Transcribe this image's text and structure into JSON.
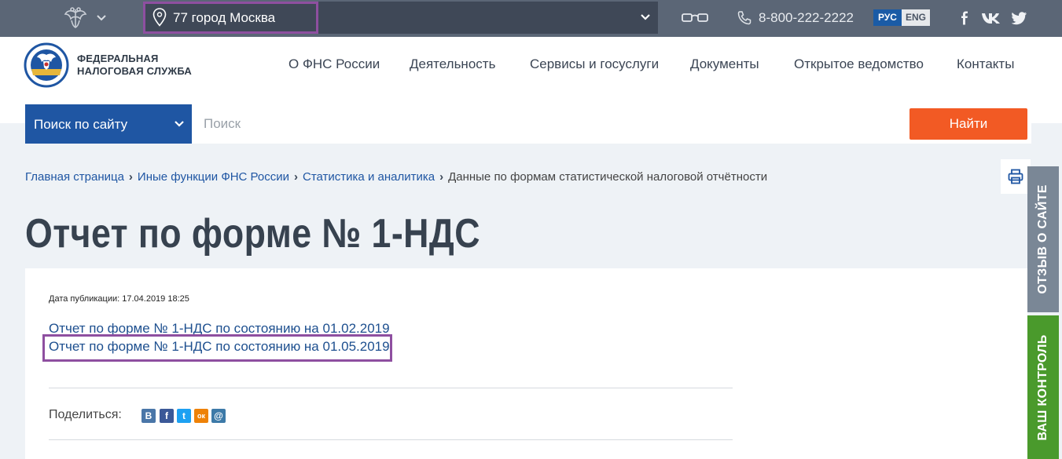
{
  "topbar": {
    "region": "77 город Москва",
    "phone": "8-800-222-2222",
    "lang_ru": "РУС",
    "lang_en": "ENG"
  },
  "header": {
    "logo_line1": "ФЕДЕРАЛЬНАЯ",
    "logo_line2": "НАЛОГОВАЯ СЛУЖБА",
    "nav": [
      "О ФНС России",
      "Деятельность",
      "Сервисы и госуслуги",
      "Документы",
      "Открытое ведомство",
      "Контакты"
    ]
  },
  "search": {
    "scope": "Поиск по сайту",
    "placeholder": "Поиск",
    "button": "Найти"
  },
  "breadcrumb": [
    "Главная страница",
    "Иные функции ФНС России",
    "Статистика и аналитика",
    "Данные по формам статистической налоговой отчётности"
  ],
  "page_title": "Отчет по форме № 1-НДС",
  "content": {
    "publication_date": "Дата публикации: 17.04.2019 18:25",
    "links": [
      "Отчет по форме № 1-НДС по состоянию на 01.02.2019",
      "Отчет по форме № 1-НДС по состоянию на 01.05.2019"
    ],
    "share_label": "Поделиться:",
    "share_icons": [
      {
        "name": "vk",
        "glyph": "В",
        "color": "#4a76a8"
      },
      {
        "name": "facebook",
        "glyph": "f",
        "color": "#3b5998"
      },
      {
        "name": "twitter",
        "glyph": "t",
        "color": "#1da1f2"
      },
      {
        "name": "odnoklassniki",
        "glyph": "ок",
        "color": "#ee8208"
      },
      {
        "name": "mail",
        "glyph": "@",
        "color": "#3d7aa8"
      }
    ]
  },
  "side_tabs": {
    "feedback": "ОТЗЫВ О САЙТЕ",
    "control": "ВАШ КОНТРОЛЬ"
  },
  "colors": {
    "topbar": "#5b6676",
    "brand_blue": "#1f56a3",
    "accent_orange": "#f25a24",
    "highlight": "#8e4fa0",
    "tab_gray": "#7a8796",
    "tab_green": "#4a9a2c"
  }
}
